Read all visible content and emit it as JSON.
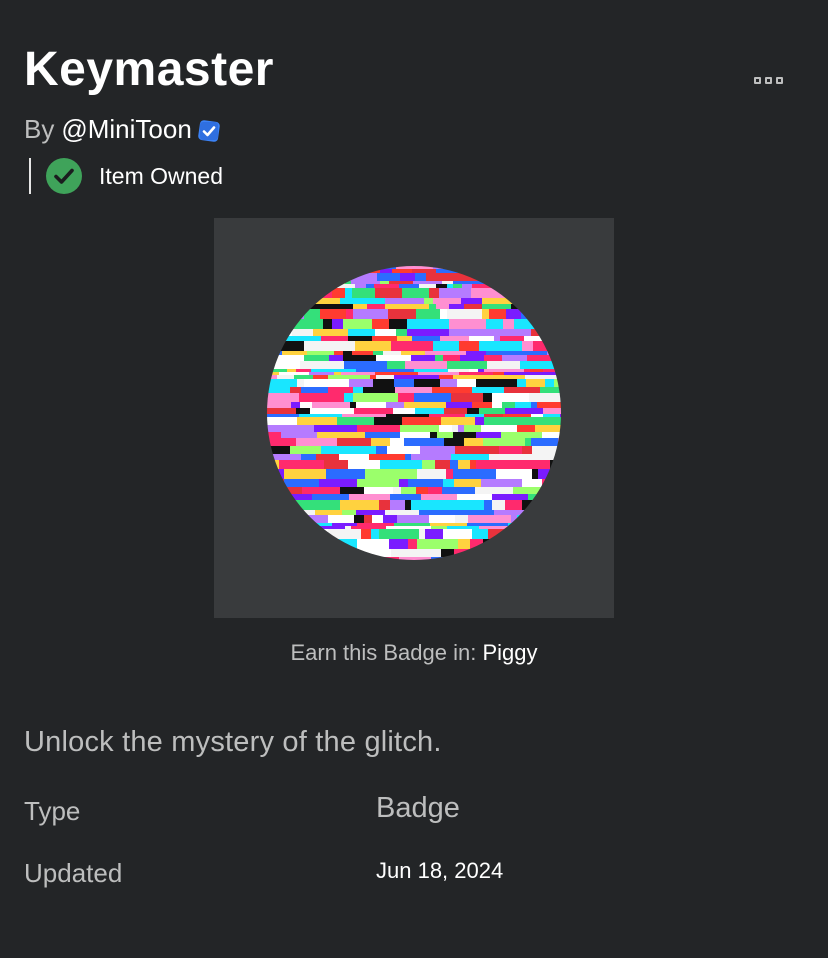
{
  "header": {
    "title": "Keymaster",
    "by_prefix": "By",
    "creator": "@MiniToon",
    "creator_verified_icon": "verified-badge-icon",
    "more_icon": "more-options-icon"
  },
  "ownership": {
    "label": "Item Owned",
    "icon": "check-circle-icon"
  },
  "thumbnail": {
    "subject": "glitch-badge-image"
  },
  "earn": {
    "prefix": "Earn this Badge in:",
    "game": "Piggy"
  },
  "description": "Unlock the mystery of the glitch.",
  "details": [
    {
      "label": "Type",
      "value": "Badge"
    },
    {
      "label": "Updated",
      "value": "Jun 18, 2024"
    }
  ],
  "colors": {
    "background": "#232527",
    "thumbnail_bg": "#393b3d",
    "owned_green": "#3fa35a",
    "verified_blue": "#3b82f6"
  }
}
